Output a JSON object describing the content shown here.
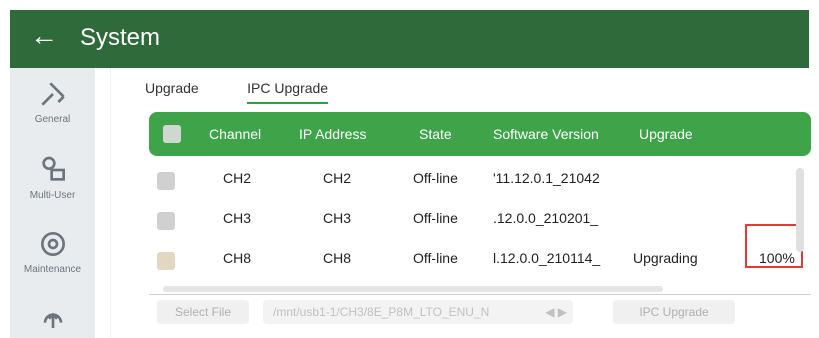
{
  "header": {
    "title": "System",
    "back_icon": "back-arrow-icon"
  },
  "sidebar": {
    "items": [
      {
        "label": "General",
        "icon": "wrench-screwdriver-icon"
      },
      {
        "label": "Multi-User",
        "icon": "user-icon"
      },
      {
        "label": "Maintenance",
        "icon": "maintenance-icon"
      },
      {
        "label": "",
        "icon": "upgrade-icon"
      }
    ]
  },
  "tabs": [
    {
      "label": "Upgrade"
    },
    {
      "label": "IPC Upgrade"
    }
  ],
  "table": {
    "headers": [
      "Channel",
      "IP Address",
      "State",
      "Software Version",
      "Upgrade"
    ],
    "rows": [
      {
        "channel": "CH2",
        "ip": "CH2",
        "state": "Off-line",
        "version": "'11.12.0.1_21042",
        "upgrade": "",
        "progress": ""
      },
      {
        "channel": "CH3",
        "ip": "CH3",
        "state": "Off-line",
        "version": ".12.0.0_210201_",
        "upgrade": "",
        "progress": ""
      },
      {
        "channel": "CH8",
        "ip": "CH8",
        "state": "Off-line",
        "version": "l.12.0.0_210114_",
        "upgrade": "Upgrading",
        "progress": "100%"
      }
    ]
  },
  "footer": {
    "select_file_label": "Select File",
    "path_value": "/mnt/usb1-1/CH3/8E_P8M_LTO_ENU_N",
    "ipc_upgrade_label": "IPC Upgrade"
  },
  "colors": {
    "header_bg": "#2f6a3a",
    "table_header_bg": "#3fa34a",
    "accent": "#2fa13a",
    "highlight": "#e53935"
  }
}
